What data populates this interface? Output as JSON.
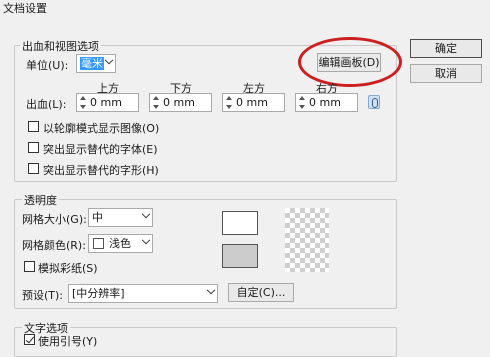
{
  "window": {
    "title": "文档设置"
  },
  "buttons": {
    "ok": "确定",
    "cancel": "取消"
  },
  "bleed_group": {
    "legend": "出血和视图选项",
    "unit_label": "单位(U):",
    "unit_value": "毫米",
    "edit_artboards": "编辑画板(D)",
    "headers": {
      "top": "上方",
      "bottom": "下方",
      "left": "左方",
      "right": "右方"
    },
    "bleed_label": "出血(L):",
    "values": {
      "top": "0 mm",
      "bottom": "0 mm",
      "left": "0 mm",
      "right": "0 mm"
    },
    "checkboxes": [
      {
        "label": "以轮廓模式显示图像(O)",
        "checked": false
      },
      {
        "label": "突出显示替代的字体(E)",
        "checked": false
      },
      {
        "label": "突出显示替代的字形(H)",
        "checked": false
      }
    ]
  },
  "transparency_group": {
    "legend": "透明度",
    "grid_size_label": "网格大小(G):",
    "grid_size_value": "中",
    "grid_color_label": "网格颜色(R):",
    "grid_color_value": "浅色",
    "simulate_paper": {
      "label": "模拟彩纸(S)",
      "checked": false
    },
    "preset_label": "预设(T):",
    "preset_value": "[中分辨率]",
    "custom_button": "自定(C)...",
    "colors": {
      "swatch_top": "#ffffff",
      "swatch_bottom": "#cccccc",
      "highlight": "#cc1f1f"
    }
  },
  "text_group": {
    "legend": "文字选项",
    "use_quotes": {
      "label": "使用引号(Y)",
      "checked": true
    }
  }
}
